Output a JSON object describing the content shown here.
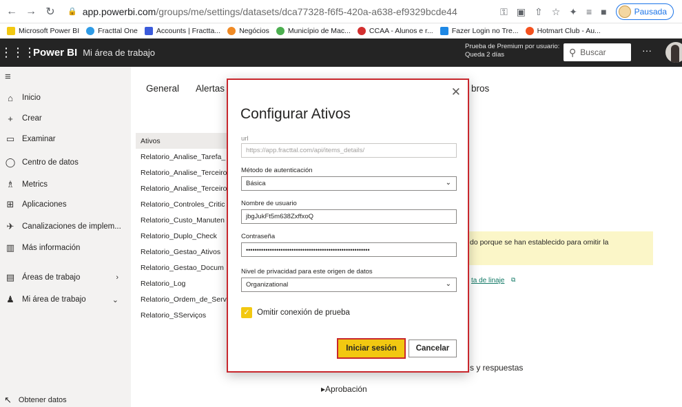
{
  "browser": {
    "url_host": "app.powerbi.com",
    "url_path": "/groups/me/settings/datasets/dca77328-f6f5-420a-a638-ef9329bcde44",
    "profile_label": "Pausada",
    "bookmarks": [
      {
        "label": "Microsoft Power BI",
        "color": "#f2c811"
      },
      {
        "label": "Fracttal One",
        "color": "#2e9be6"
      },
      {
        "label": "Accounts | Fractta...",
        "color": "#3b5bdb"
      },
      {
        "label": "Negócios",
        "color": "#f08a24"
      },
      {
        "label": "Município de Mac...",
        "color": "#4caf50"
      },
      {
        "label": "CCAA - Alunos e r...",
        "color": "#d32f2f"
      },
      {
        "label": "Fazer Login no Tre...",
        "color": "#1e88e5"
      },
      {
        "label": "Hotmart Club - Au...",
        "color": "#f4511e"
      }
    ]
  },
  "header": {
    "app_name": "Power BI",
    "workspace": "Mi área de trabajo",
    "trial_line1": "Prueba de Premium por usuario:",
    "trial_line2": "Queda 2 días",
    "search_placeholder": "Buscar",
    "more": "···"
  },
  "nav": {
    "items": [
      {
        "label": "Inicio",
        "icon": "home-icon",
        "glyph": "⌂"
      },
      {
        "label": "Crear",
        "icon": "plus-icon",
        "glyph": "+"
      },
      {
        "label": "Examinar",
        "icon": "folder-icon",
        "glyph": "▭"
      },
      {
        "label": "Centro de datos",
        "icon": "database-icon",
        "glyph": "◯"
      },
      {
        "label": "Metrics",
        "icon": "trophy-icon",
        "glyph": "♗"
      },
      {
        "label": "Aplicaciones",
        "icon": "apps-icon",
        "glyph": "⊞"
      },
      {
        "label": "Canalizaciones de implem...",
        "icon": "rocket-icon",
        "glyph": "✈"
      },
      {
        "label": "Más información",
        "icon": "book-icon",
        "glyph": "▥"
      },
      {
        "label": "Áreas de trabajo",
        "icon": "workspaces-icon",
        "glyph": "▤"
      },
      {
        "label": "Mi área de trabajo",
        "icon": "user-icon",
        "glyph": "♟"
      }
    ],
    "get_data": "Obtener datos"
  },
  "settings": {
    "tabs": [
      "General",
      "Alertas",
      "bros"
    ],
    "datasets": [
      "Ativos",
      "Relatorio_Analise_Tarefa_",
      "Relatorio_Analise_Terceiro",
      "Relatorio_Analise_Terceiro",
      "Relatorio_Controles_Critic",
      "Relatorio_Custo_Manuten",
      "Relatorio_Duplo_Check",
      "Relatorio_Gestao_Ativos",
      "Relatorio_Gestao_Docum",
      "Relatorio_Log",
      "Relatorio_Ordem_de_Serv",
      "Relatorio_SServiços"
    ],
    "warning_text": "do porque se han establecido para omitir la",
    "lineage_link": "ta de linaje",
    "qa_section": "s y respuestas",
    "approval_section": "▸Aprobación"
  },
  "dialog": {
    "title": "Configurar Ativos",
    "url_label": "url",
    "url_value": "https://app.fracttal.com/api/items_details/",
    "auth_label": "Método de autenticación",
    "auth_value": "Básica",
    "user_label": "Nombre de usuario",
    "user_value": "jbgJukFt5m638ZxffxoQ",
    "password_label": "Contraseña",
    "password_value": "•••••••••••••••••••••••••••••••••••••••••••••••••••••••••",
    "privacy_label": "Nivel de privacidad para este origen de datos",
    "privacy_value": "Organizational",
    "skip_test_label": "Omitir conexión de prueba",
    "skip_test_checked": true,
    "signin_label": "Iniciar sesión",
    "cancel_label": "Cancelar",
    "accent": "#f2c811",
    "highlight": "#c8262c"
  }
}
